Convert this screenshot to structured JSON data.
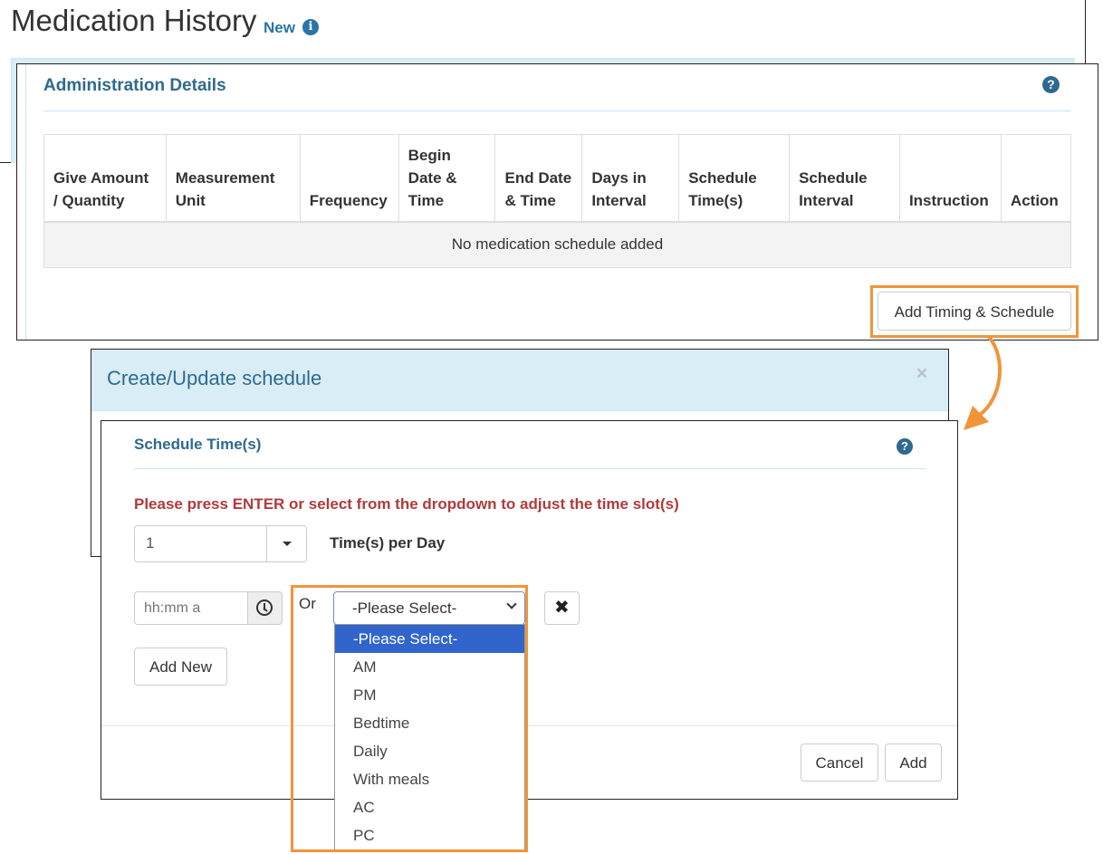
{
  "medication_history": {
    "title": "Medication History",
    "new_label": "New",
    "info_icon": "info-circle-icon"
  },
  "administration_details": {
    "title": "Administration Details",
    "help_icon": "question-circle-icon",
    "table": {
      "columns": [
        "Give Amount / Quantity",
        "Measurement Unit",
        "Frequency",
        "Begin Date & Time",
        "End Date & Time",
        "Days in Interval",
        "Schedule Time(s)",
        "Schedule Interval",
        "Instruction",
        "Action"
      ],
      "empty_message": "No medication schedule added"
    },
    "add_timing_label": "Add Timing & Schedule"
  },
  "schedule_modal": {
    "title": "Create/Update schedule",
    "close_symbol": "×",
    "section_title": "Schedule Time(s)",
    "help_icon": "question-circle-icon",
    "instruction": "Please press ENTER or select from the dropdown to adjust the time slot(s)",
    "times_per_day_value": "1",
    "times_per_day_label": "Time(s) per Day",
    "time_placeholder": "hh:mm a",
    "or_label": "Or",
    "period_select_value": "-Please Select-",
    "remove_symbol": "✖",
    "add_new_label": "Add New",
    "cancel_label": "Cancel",
    "add_label": "Add"
  },
  "period_options": [
    "-Please Select-",
    "AM",
    "PM",
    "Bedtime",
    "Daily",
    "With meals",
    "AC",
    "PC"
  ],
  "colors": {
    "highlight": "#f0953a",
    "heading_blue": "#2e6a8e",
    "link_blue": "#2a74a8",
    "panel_header_bg": "#d9edf7",
    "instruction_red": "#b03a3a",
    "selected_option": "#3165cc"
  }
}
